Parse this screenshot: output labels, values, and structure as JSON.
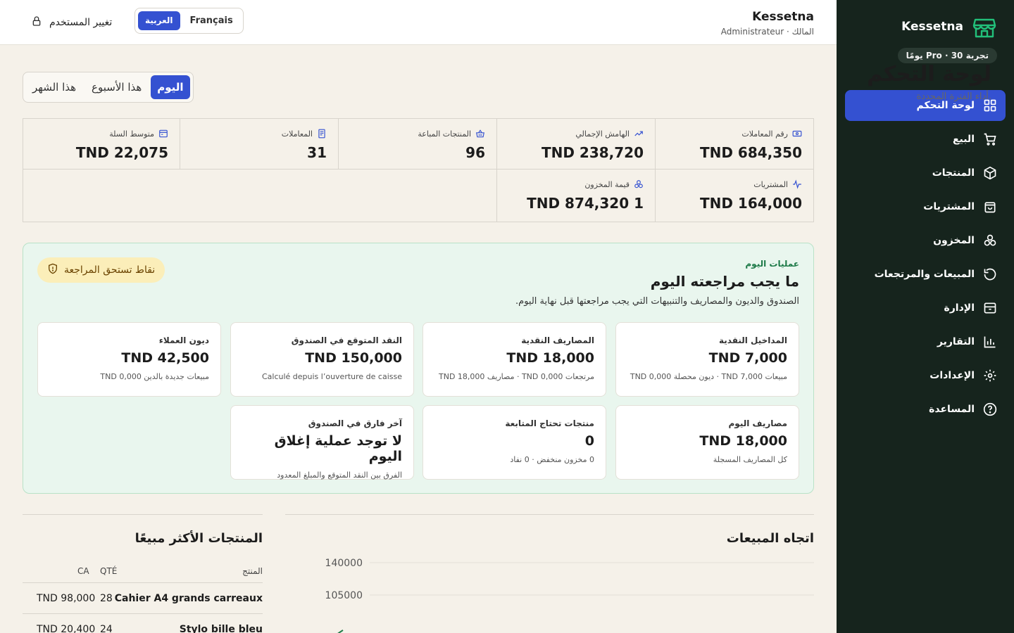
{
  "sidebar": {
    "brand": "Kessetna",
    "trial": "تجربة 30 · Pro يومًا",
    "items": [
      {
        "label": "لوحة التحكم",
        "icon": "dashboard-icon"
      },
      {
        "label": "البيع",
        "icon": "cart-icon"
      },
      {
        "label": "المنتجات",
        "icon": "box-icon"
      },
      {
        "label": "المشتريات",
        "icon": "bag-icon"
      },
      {
        "label": "المخزون",
        "icon": "stock-icon"
      },
      {
        "label": "المبيعات والمرتجعات",
        "icon": "return-icon"
      },
      {
        "label": "الإدارة",
        "icon": "archive-icon"
      },
      {
        "label": "التقارير",
        "icon": "chart-icon"
      },
      {
        "label": "الإعدادات",
        "icon": "gear-icon"
      },
      {
        "label": "المساعدة",
        "icon": "help-icon"
      }
    ]
  },
  "header": {
    "user_name": "Kessetna",
    "user_role": "المالك · Administrateur",
    "lang_fr": "Français",
    "lang_ar": "العربية",
    "change_user": "تغيير المستخدم"
  },
  "page": {
    "title": "لوحة التحكم",
    "subtitle": "أداء الفترة المحددة.",
    "periods": [
      "اليوم",
      "هذا الأسبوع",
      "هذا الشهر"
    ]
  },
  "kpis": [
    {
      "label": "رقم المعاملات",
      "value": "TND 684,350",
      "icon": "money-icon"
    },
    {
      "label": "الهامش الإجمالي",
      "value": "TND 238,720",
      "icon": "trend-up-icon"
    },
    {
      "label": "المنتجات المباعة",
      "value": "96",
      "icon": "basket-icon"
    },
    {
      "label": "المعاملات",
      "value": "31",
      "icon": "receipt-icon"
    },
    {
      "label": "متوسط السلة",
      "value": "TND 22,075",
      "icon": "wallet-icon"
    },
    {
      "label": "المشتريات",
      "value": "TND 164,000",
      "icon": "pulse-icon"
    },
    {
      "label": "قيمة المخزون",
      "value": "TND 874,320 1",
      "icon": "boxes-icon"
    }
  ],
  "review": {
    "eyebrow": "عمليات اليوم",
    "title": "ما يجب مراجعته اليوم",
    "desc": "الصندوق والديون والمصاريف والتنبيهات التي يجب مراجعتها قبل نهاية اليوم.",
    "badge": "نقاط تستحق المراجعة",
    "cards": [
      {
        "label": "المداخيل النقدية",
        "value": "TND 7,000",
        "note": "مبيعات TND 7,000 · ديون محصلة TND 0,000"
      },
      {
        "label": "المصاريف النقدية",
        "value": "TND 18,000",
        "note": "مرتجعات TND 0,000 · مصاريف TND 18,000"
      },
      {
        "label": "النقد المتوقع في الصندوق",
        "value": "TND 150,000",
        "note": "Calculé depuis l’ouverture de caisse"
      },
      {
        "label": "ديون العملاء",
        "value": "TND 42,500",
        "note": "مبيعات جديدة بالدين TND 0,000"
      },
      {
        "label": "مصاريف اليوم",
        "value": "TND 18,000",
        "note": "كل المصاريف المسجلة"
      },
      {
        "label": "منتجات تحتاج المتابعة",
        "value": "0",
        "note": "0 مخزون منخفض · 0 نفاد"
      },
      {
        "label": "آخر فارق في الصندوق",
        "value": "لا توجد عملية إغلاق اليوم",
        "note": "الفرق بين النقد المتوقع والمبلغ المعدود"
      }
    ]
  },
  "sales_trend": {
    "title": "اتجاه المبيعات"
  },
  "chart_data": {
    "type": "line",
    "title": "اتجاه المبيعات",
    "y_ticks": [
      140000,
      105000
    ],
    "ylim": [
      0,
      140000
    ],
    "grid": true
  },
  "top_products": {
    "title": "المنتجات الأكثر مبيعًا",
    "headers": {
      "product": "المنتج",
      "qty": "QTÉ",
      "ca": "CA"
    },
    "rows": [
      {
        "product": "Cahier A4 grands carreaux",
        "qty": "28",
        "ca": "TND 98,000"
      },
      {
        "product": "Stylo bille bleu",
        "qty": "24",
        "ca": "TND 20,400"
      }
    ]
  },
  "colors": {
    "accent": "#3451d1",
    "sidebar": "#16241d",
    "background": "#f5f1e9",
    "review_bg": "#e9f6ee",
    "success": "#1e7a48",
    "warning_bg": "#fbeeb9"
  }
}
